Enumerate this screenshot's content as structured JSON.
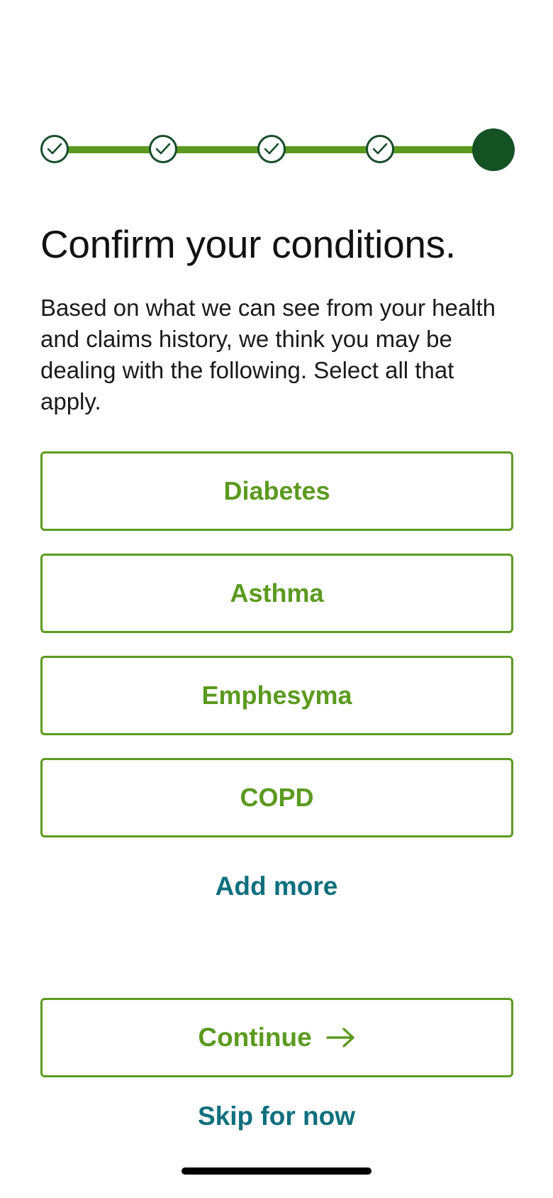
{
  "progress": {
    "total_steps": 5,
    "completed_steps": 4,
    "current_step": 5
  },
  "header": {
    "title": "Confirm your conditions."
  },
  "intro": {
    "text": "Based on what we can see from your health and claims history, we think you may be dealing with the following. Select all that apply."
  },
  "conditions": [
    {
      "label": "Diabetes"
    },
    {
      "label": "Asthma"
    },
    {
      "label": "Emphesyma"
    },
    {
      "label": "COPD"
    }
  ],
  "actions": {
    "add_more": "Add more",
    "continue": "Continue",
    "skip": "Skip for now"
  },
  "icons": {
    "step_done": "check-icon",
    "continue": "arrow-right-icon"
  },
  "colors": {
    "accent_green": "#5b9a1f",
    "dark_green": "#145123",
    "link_teal": "#0e6f7d"
  }
}
